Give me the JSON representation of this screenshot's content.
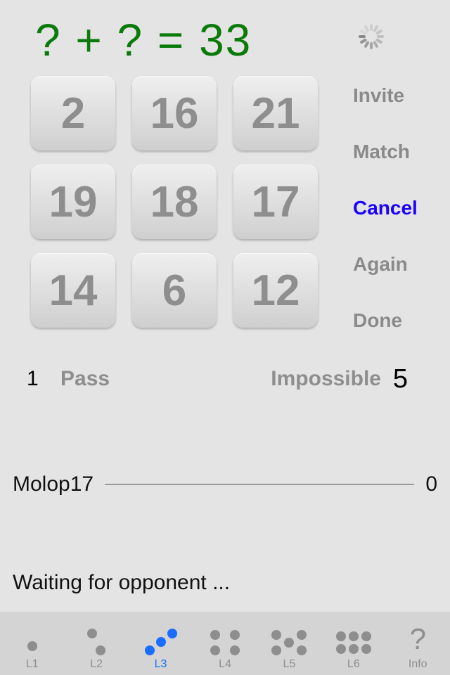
{
  "equation": "? + ? = 33",
  "tiles": [
    "2",
    "16",
    "21",
    "19",
    "18",
    "17",
    "14",
    "6",
    "12"
  ],
  "menu": [
    {
      "label": "Invite",
      "active": false
    },
    {
      "label": "Match",
      "active": false
    },
    {
      "label": "Cancel",
      "active": true
    },
    {
      "label": "Again",
      "active": false
    },
    {
      "label": "Done",
      "active": false
    }
  ],
  "controls": {
    "left_number": "1",
    "pass_label": "Pass",
    "impossible_label": "Impossible",
    "right_number": "5"
  },
  "player": {
    "name": "Molop17",
    "score": "0"
  },
  "opponent": {
    "name": "",
    "score": ""
  },
  "status": "Waiting for opponent ...",
  "tabs": [
    {
      "label": "L1",
      "active": false
    },
    {
      "label": "L2",
      "active": false
    },
    {
      "label": "L3",
      "active": true
    },
    {
      "label": "L4",
      "active": false
    },
    {
      "label": "L5",
      "active": false
    },
    {
      "label": "L6",
      "active": false
    },
    {
      "label": "Info",
      "active": false
    }
  ]
}
